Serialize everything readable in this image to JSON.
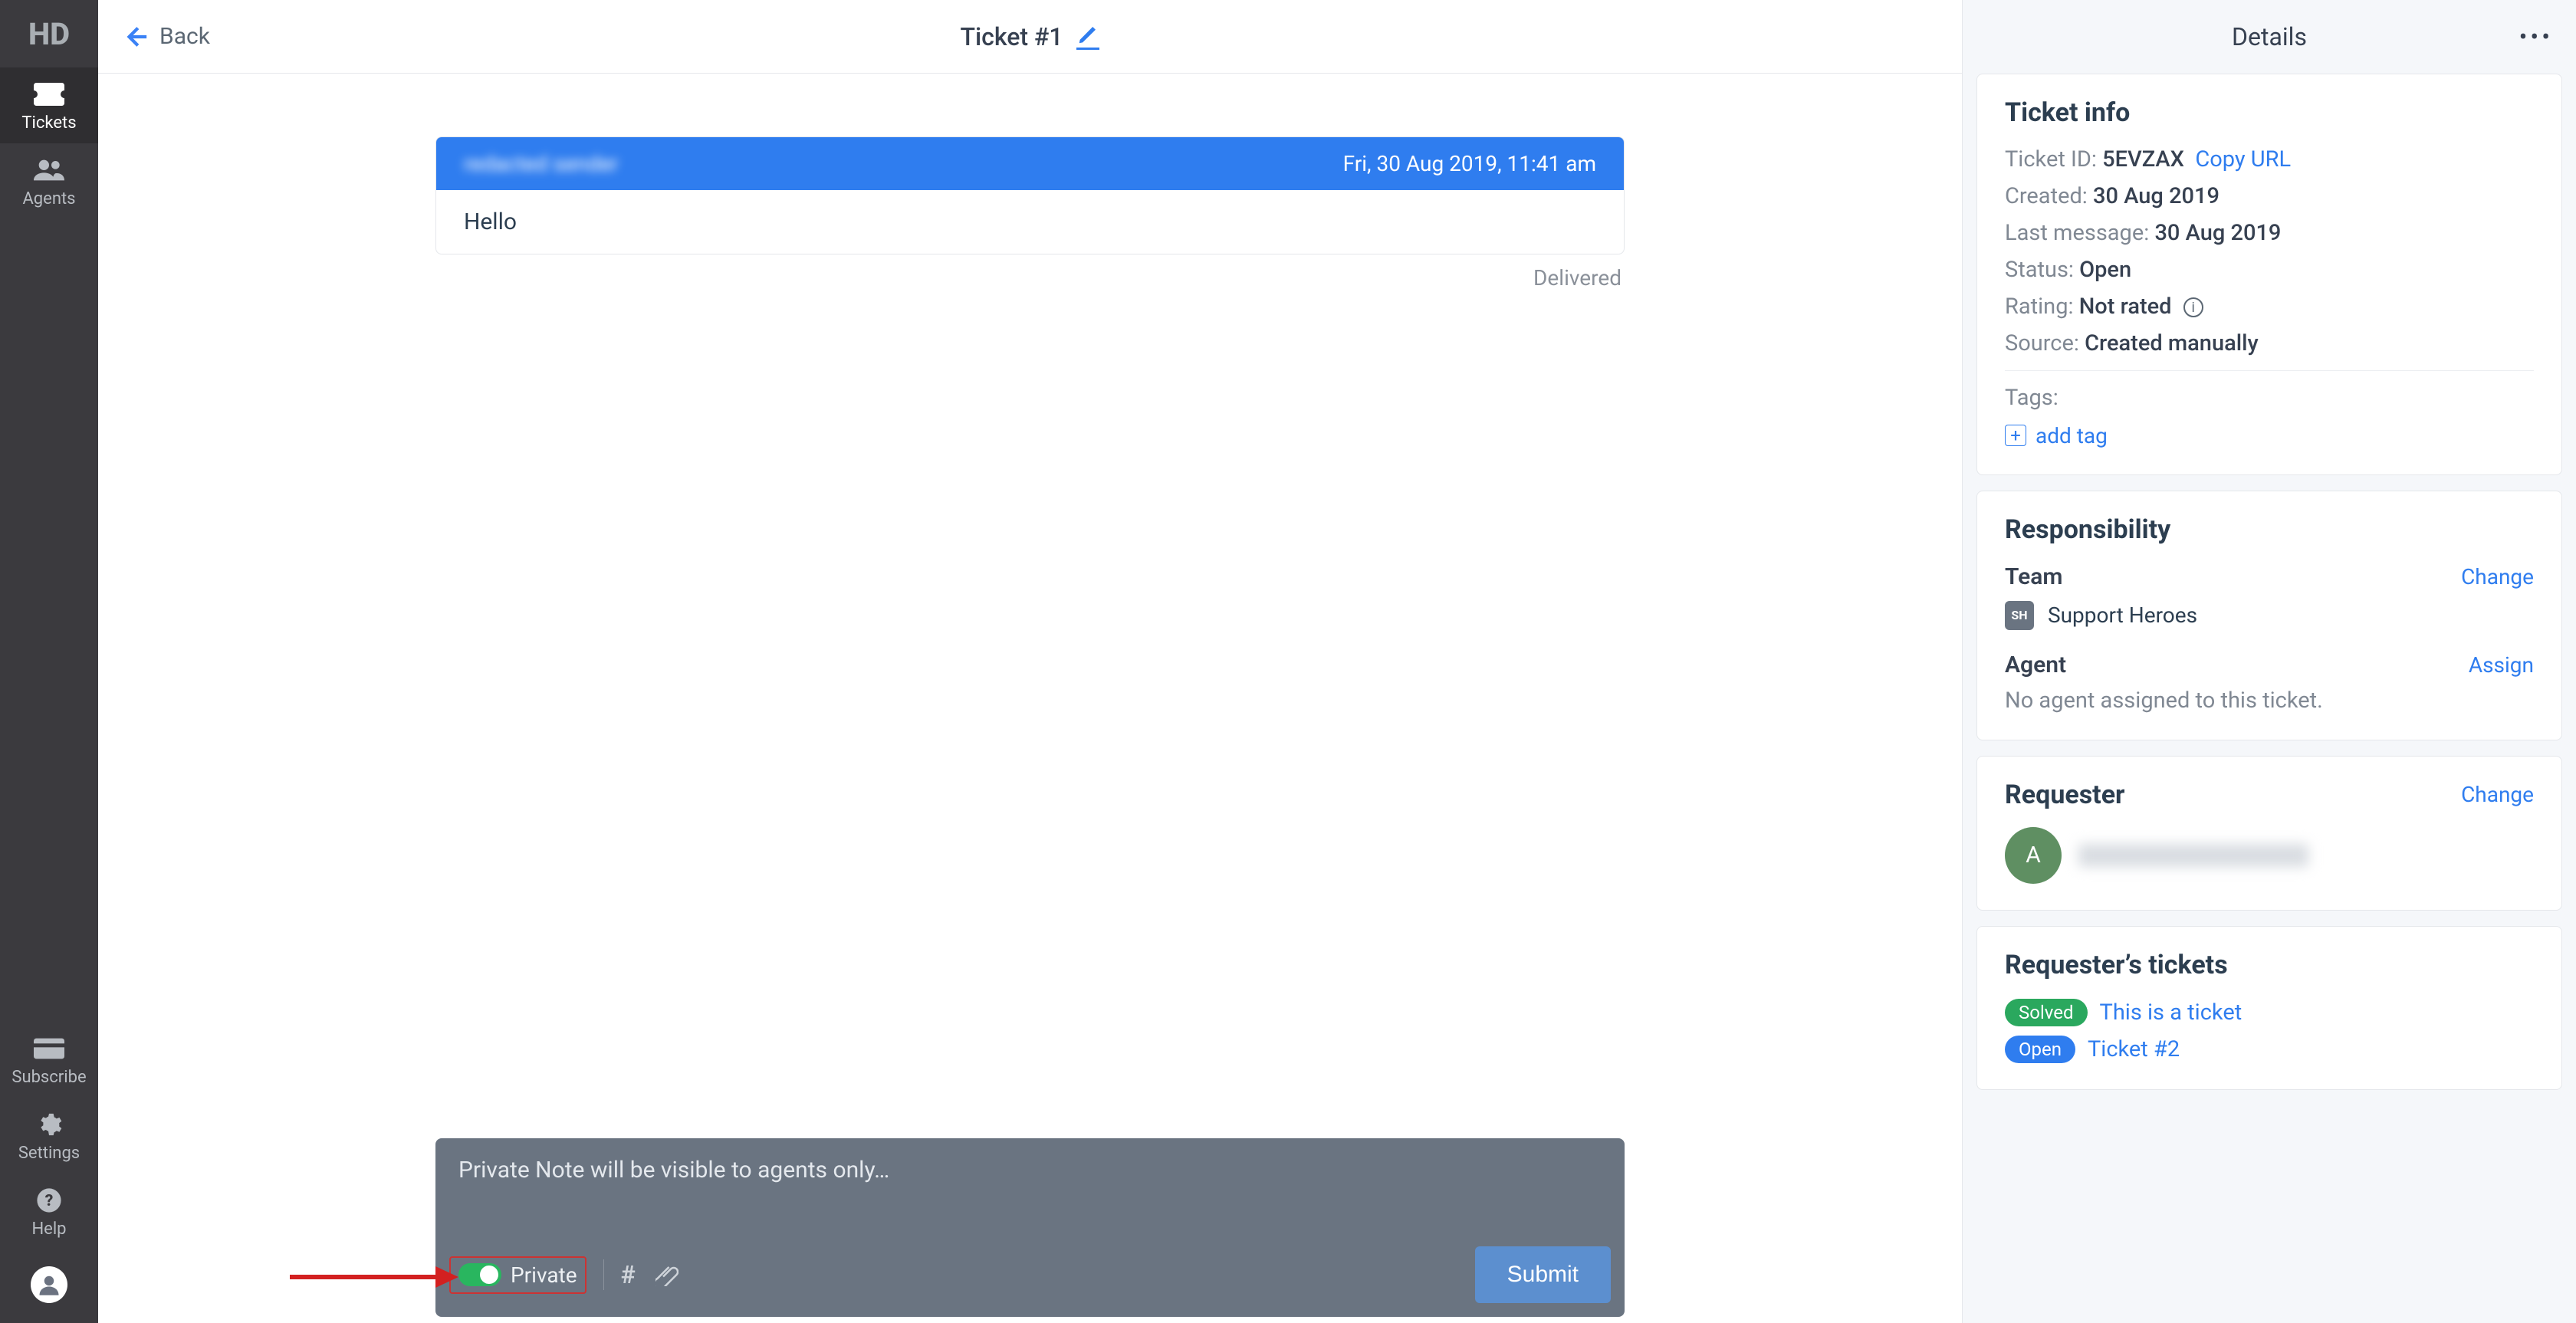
{
  "nav": {
    "logo": "HD",
    "items": [
      {
        "key": "tickets",
        "label": "Tickets",
        "active": true
      },
      {
        "key": "agents",
        "label": "Agents",
        "active": false
      }
    ],
    "bottom": [
      {
        "key": "subscribe",
        "label": "Subscribe"
      },
      {
        "key": "settings",
        "label": "Settings"
      },
      {
        "key": "help",
        "label": "Help"
      }
    ]
  },
  "header": {
    "back": "Back",
    "title": "Ticket #1"
  },
  "message": {
    "from": "redacted sender",
    "timestamp": "Fri, 30 Aug 2019, 11:41 am",
    "body": "Hello",
    "status": "Delivered"
  },
  "composer": {
    "placeholder": "Private Note will be visible to agents only…",
    "private_label": "Private",
    "submit": "Submit"
  },
  "details": {
    "title": "Details",
    "ticket_info": {
      "heading": "Ticket info",
      "id_label": "Ticket ID:",
      "id_value": "5EVZAX",
      "copy": "Copy URL",
      "created_label": "Created:",
      "created_value": "30 Aug 2019",
      "last_label": "Last message:",
      "last_value": "30 Aug 2019",
      "status_label": "Status:",
      "status_value": "Open",
      "rating_label": "Rating:",
      "rating_value": "Not rated",
      "source_label": "Source:",
      "source_value": "Created manually",
      "tags_label": "Tags:",
      "add_tag": "add tag"
    },
    "responsibility": {
      "heading": "Responsibility",
      "team_label": "Team",
      "team_change": "Change",
      "team_badge": "SH",
      "team_name": "Support Heroes",
      "agent_label": "Agent",
      "agent_assign": "Assign",
      "agent_none": "No agent assigned to this ticket."
    },
    "requester": {
      "heading": "Requester",
      "change": "Change",
      "initial": "A"
    },
    "requester_tickets": {
      "heading": "Requester’s tickets",
      "items": [
        {
          "status": "Solved",
          "status_class": "solved",
          "title": "This is a ticket"
        },
        {
          "status": "Open",
          "status_class": "open",
          "title": "Ticket #2"
        }
      ]
    }
  }
}
